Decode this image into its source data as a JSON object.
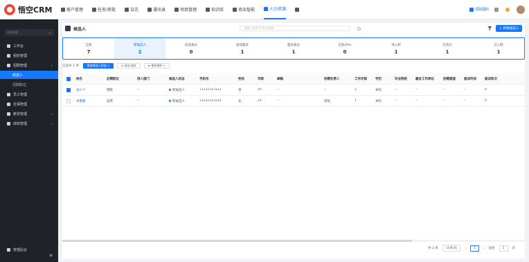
{
  "app": {
    "logo_text": "悟空CRM"
  },
  "nav": {
    "items": [
      {
        "label": "客户管理",
        "icon": "customer-icon"
      },
      {
        "label": "任务/审批",
        "icon": "task-icon"
      },
      {
        "label": "日志",
        "icon": "log-icon"
      },
      {
        "label": "通讯录",
        "icon": "contacts-icon"
      },
      {
        "label": "项目管理",
        "icon": "project-icon"
      },
      {
        "label": "知识库",
        "icon": "knowledge-icon"
      },
      {
        "label": "商业智能",
        "icon": "bi-icon"
      },
      {
        "label": "人力资源",
        "icon": "hr-icon",
        "active": true
      },
      {
        "label": "",
        "icon": "grid-icon"
      }
    ],
    "right": {
      "gift_label": "领取福利"
    }
  },
  "sidebar": {
    "quick_create": "快速创建",
    "items": [
      {
        "label": "工作台",
        "icon": "dashboard-icon"
      },
      {
        "label": "组织管理",
        "icon": "org-icon"
      },
      {
        "label": "招聘管理",
        "icon": "recruit-icon",
        "expanded": true
      }
    ],
    "sub_items": [
      {
        "label": "候选人",
        "active": true
      },
      {
        "label": "招聘职位",
        "active": false
      }
    ],
    "more_items": [
      {
        "label": "员工管理",
        "icon": "employee-icon"
      },
      {
        "label": "社保管理",
        "icon": "insurance-icon"
      },
      {
        "label": "薪资管理",
        "icon": "salary-icon"
      },
      {
        "label": "绩效管理",
        "icon": "performance-icon"
      }
    ],
    "bottom": {
      "label": "管理后台"
    }
  },
  "page": {
    "title": "候选人",
    "search_placeholder": "请输入姓名/手机号/邮箱",
    "new_button": "+ 新建候选人"
  },
  "stats": [
    {
      "label": "全部",
      "value": "7"
    },
    {
      "label": "新候选人",
      "value": "2",
      "selected": true
    },
    {
      "label": "初选通过",
      "value": "0"
    },
    {
      "label": "安排面试",
      "value": "1"
    },
    {
      "label": "面试通过",
      "value": "1"
    },
    {
      "label": "已发offer",
      "value": "0"
    },
    {
      "label": "待入职",
      "value": "1"
    },
    {
      "label": "已淘汰",
      "value": "1"
    },
    {
      "label": "已入职",
      "value": "1"
    }
  ],
  "toolbar": {
    "selected_text": "已选中 1 项",
    "btn_status": "更改候选人状态 ∨",
    "btn_eliminate": "⊘ 淘汰/流失",
    "btn_more": "⇄ 更多操作 ∨"
  },
  "table": {
    "headers": [
      "姓名",
      "应聘职位",
      "用人部门",
      "候选人状态",
      "手机号",
      "性别",
      "年龄",
      "邮箱",
      "招聘负责人",
      "工作年限",
      "学历",
      "毕业院校",
      "最近工作单位",
      "招聘渠道",
      "面试时间",
      "面试轮次"
    ],
    "rows": [
      {
        "checked": true,
        "cells": [
          "张人个",
          "销售",
          "--",
          "新候选人",
          "13131313131",
          "男",
          "26",
          "--",
          "--",
          "2",
          "本科",
          "--",
          "--",
          "--",
          "--",
          "0"
        ]
      },
      {
        "checked": false,
        "cells": [
          "米塞塞",
          "运营",
          "--",
          "新候选人",
          "13131313313",
          "女",
          "24",
          "--",
          "测试",
          "1",
          "本科",
          "--",
          "--",
          "--",
          "--",
          "0"
        ]
      }
    ]
  },
  "pager": {
    "total": "共 2 条",
    "page_size": "15条/页",
    "current": "1",
    "goto_label": "前往",
    "goto_value": "1",
    "page_suffix": "页"
  }
}
